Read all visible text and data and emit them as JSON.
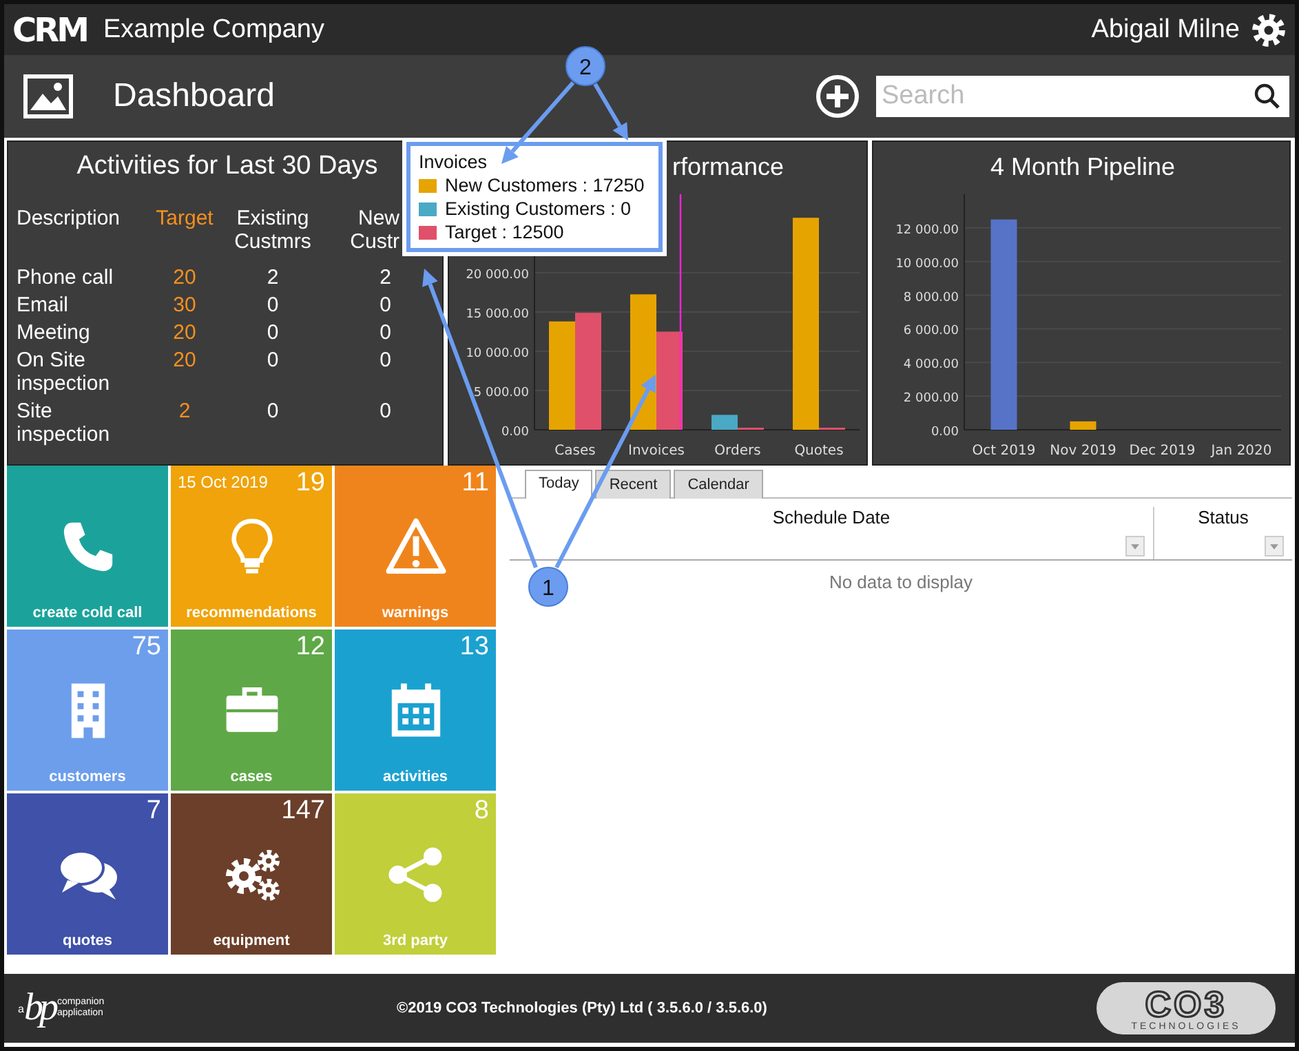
{
  "header": {
    "logo": "CRM",
    "company": "Example Company",
    "user": "Abigail Milne"
  },
  "nav": {
    "title": "Dashboard",
    "search": {
      "placeholder": "Search"
    }
  },
  "activities": {
    "title": "Activities for Last 30 Days",
    "columns": [
      "Description",
      "Target",
      "Existing Custmrs",
      "New Custr"
    ],
    "rows": [
      {
        "description": "Phone call",
        "target": "20",
        "existing": "2",
        "new": "2"
      },
      {
        "description": "Email",
        "target": "30",
        "existing": "0",
        "new": "0"
      },
      {
        "description": "Meeting",
        "target": "20",
        "existing": "0",
        "new": "0"
      },
      {
        "description": "On Site inspection",
        "target": "20",
        "existing": "0",
        "new": "0"
      },
      {
        "description": "Site inspection",
        "target": "2",
        "existing": "0",
        "new": "0"
      }
    ]
  },
  "performance": {
    "chart_data": {
      "type": "bar",
      "title": "rformance",
      "categories": [
        "Cases",
        "Invoices",
        "Orders",
        "Quotes"
      ],
      "series": [
        {
          "color": "#e6a400",
          "values": [
            13800,
            17250,
            null,
            27000
          ]
        },
        {
          "color": "#4aa9c4",
          "values": [
            null,
            0,
            1900,
            null
          ]
        },
        {
          "color": "#e0506a",
          "values": [
            14900,
            12500,
            100,
            100
          ]
        }
      ],
      "grid": true,
      "ylim": [
        0,
        30000
      ],
      "yticks": [
        {
          "value": 0,
          "label": "0.00"
        },
        {
          "value": 5000,
          "label": "5 000.00"
        },
        {
          "value": 10000,
          "label": "10 000.00"
        },
        {
          "value": 15000,
          "label": "15 000.00"
        },
        {
          "value": 20000,
          "label": "20 000.00"
        }
      ]
    }
  },
  "tooltip": {
    "title": "Invoices",
    "items": [
      {
        "label": "New Customers : 17250",
        "color": "#e6a400"
      },
      {
        "label": "Existing Customers : 0",
        "color": "#4aa9c4"
      },
      {
        "label": "Target : 12500",
        "color": "#e0506a"
      }
    ]
  },
  "pipeline": {
    "chart_data": {
      "type": "bar",
      "title": "4 Month Pipeline",
      "categories": [
        "Oct 2019",
        "Nov 2019",
        "Dec 2019",
        "Jan 2020"
      ],
      "series": [
        {
          "color": "#5673c8",
          "values": [
            12500,
            null,
            null,
            null
          ]
        },
        {
          "color": "#e6a400",
          "values": [
            null,
            500,
            null,
            null
          ]
        }
      ],
      "grid": true,
      "ylim": [
        0,
        14000
      ],
      "yticks": [
        {
          "value": 0,
          "label": "0.00"
        },
        {
          "value": 2000,
          "label": "2 000.00"
        },
        {
          "value": 4000,
          "label": "4 000.00"
        },
        {
          "value": 6000,
          "label": "6 000.00"
        },
        {
          "value": 8000,
          "label": "8 000.00"
        },
        {
          "value": 10000,
          "label": "10 000.00"
        },
        {
          "value": 12000,
          "label": "12 000.00"
        }
      ]
    }
  },
  "tiles": [
    {
      "label": "create cold call",
      "color": "#1ba39b"
    },
    {
      "label": "recommendations",
      "date": "15 Oct 2019",
      "count": "19",
      "color": "#f0a30a"
    },
    {
      "label": "warnings",
      "count": "11",
      "color": "#f0841c"
    },
    {
      "label": "customers",
      "count": "75",
      "color": "#6d9eeb"
    },
    {
      "label": "cases",
      "count": "12",
      "color": "#5fa847"
    },
    {
      "label": "activities",
      "count": "13",
      "color": "#1ba1d0"
    },
    {
      "label": "quotes",
      "count": "7",
      "color": "#3f51a8"
    },
    {
      "label": "equipment",
      "count": "147",
      "color": "#6b3f2a"
    },
    {
      "label": "3rd party",
      "count": "8",
      "color": "#c0cf3a"
    }
  ],
  "schedule": {
    "tabs": [
      {
        "label": "Today",
        "selected": true
      },
      {
        "label": "Recent",
        "selected": false
      },
      {
        "label": "Calendar",
        "selected": false
      }
    ],
    "columns": [
      "Schedule Date",
      "Status"
    ],
    "empty": "No data to display"
  },
  "footer": {
    "left_logo": {
      "prefix": "a",
      "mark": "bp",
      "tagline": [
        "companion",
        "application"
      ]
    },
    "copyright": "©2019 CO3 Technologies (Pty) Ltd ( 3.5.6.0 / 3.5.6.0)",
    "right_logo": {
      "mark": "CO3",
      "tagline": "TECHNOLOGIES"
    }
  },
  "annotations": [
    {
      "number": "2"
    },
    {
      "number": "1"
    }
  ]
}
